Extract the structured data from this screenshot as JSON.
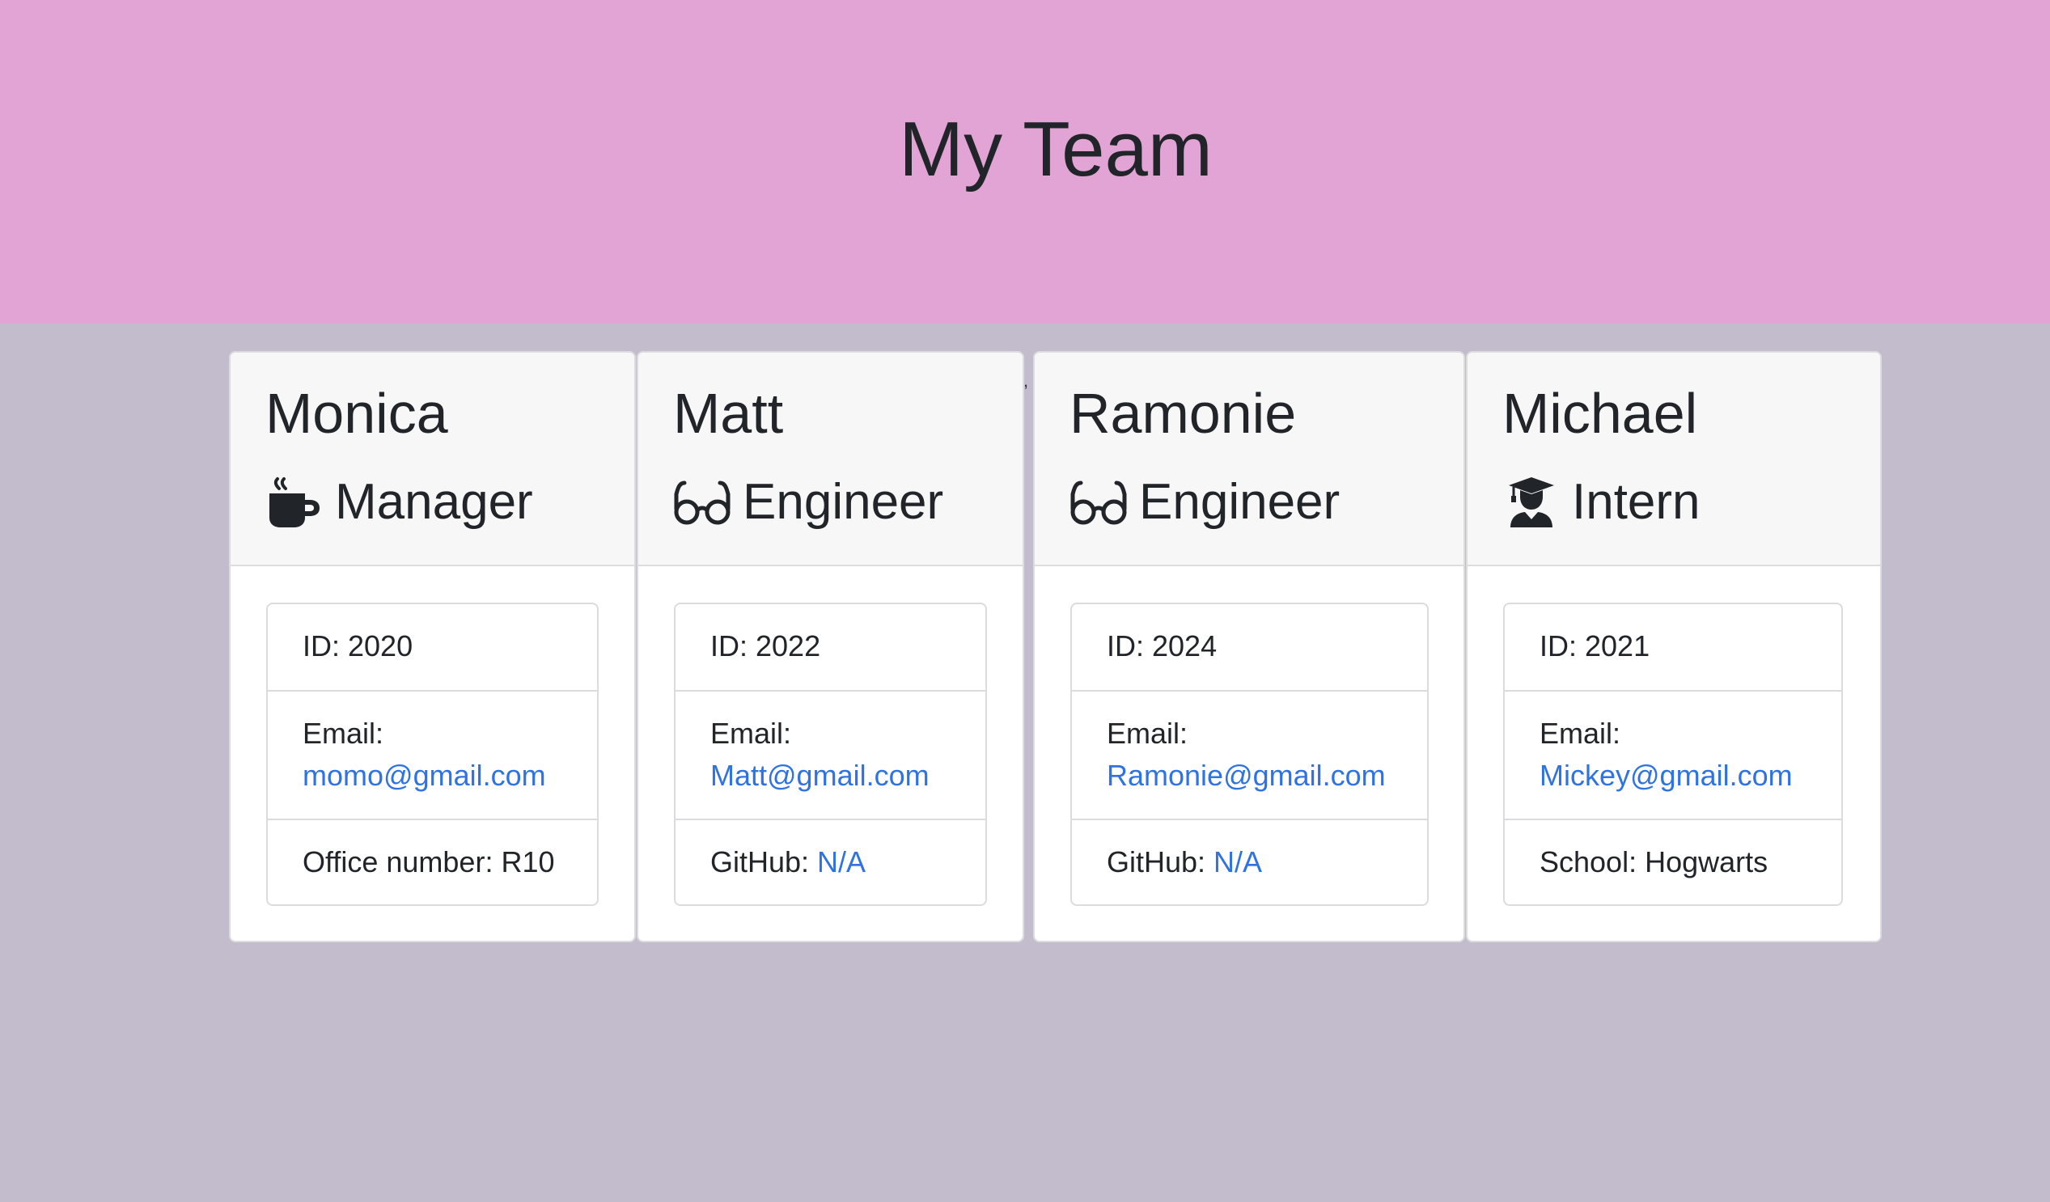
{
  "page": {
    "title": "My Team"
  },
  "colors": {
    "header_bg": "#e2a3d5",
    "page_bg": "#c3bccd",
    "link": "#2f73e3",
    "card_header_bg": "#f7f7f7"
  },
  "cards": [
    {
      "name": "Monica",
      "role": "Manager",
      "role_icon": "coffee-mug-icon",
      "id_text": "ID: 2020",
      "email_label": "Email:",
      "email": "momo@gmail.com",
      "extra_label": "Office number: R10",
      "extra_link": ""
    },
    {
      "name": "Matt",
      "role": "Engineer",
      "role_icon": "glasses-icon",
      "id_text": "ID: 2022",
      "email_label": "Email:",
      "email": "Matt@gmail.com",
      "extra_label": "GitHub: ",
      "extra_link": "N/A"
    },
    {
      "name": "Ramonie",
      "role": "Engineer",
      "role_icon": "glasses-icon",
      "id_text": "ID: 2024",
      "email_label": "Email:",
      "email": "Ramonie@gmail.com",
      "extra_label": "GitHub: ",
      "extra_link": "N/A"
    },
    {
      "name": "Michael",
      "role": "Intern",
      "role_icon": "graduate-icon",
      "id_text": "ID: 2021",
      "email_label": "Email:",
      "email": "Mickey@gmail.com",
      "extra_label": "School: Hogwarts",
      "extra_link": ""
    }
  ],
  "stray_mark": ","
}
